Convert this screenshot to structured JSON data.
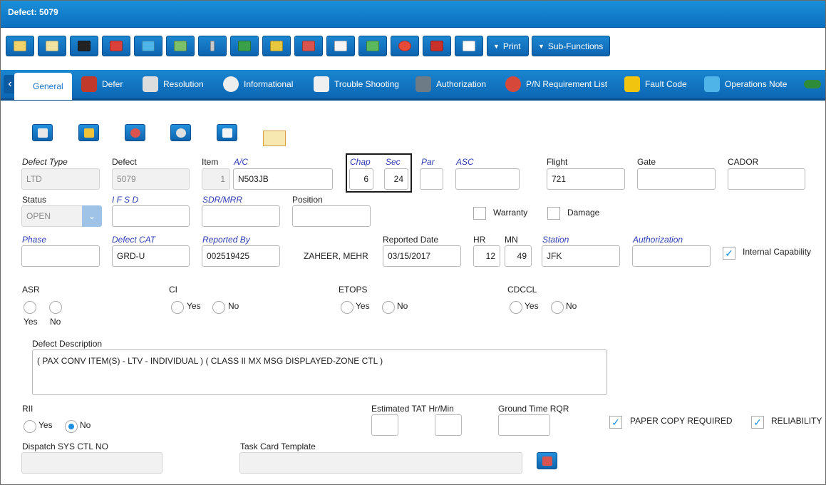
{
  "window": {
    "title": "Defect: 5079"
  },
  "toolbar": {
    "print_label": "Print",
    "subfunctions_label": "Sub-Functions",
    "buttons": [
      "new-icon",
      "copy-icon",
      "save-icon",
      "eraser-icon",
      "book-icon",
      "image-icon",
      "attach-icon",
      "checkmark-icon",
      "plane-icon",
      "parts-icon",
      "document-icon",
      "transfer-icon",
      "status-icon",
      "sign-icon",
      "card-icon"
    ]
  },
  "tabs": [
    "General",
    "Defer",
    "Resolution",
    "Informational",
    "Trouble Shooting",
    "Authorization",
    "P/N Requirement List",
    "Fault Code",
    "Operations Note"
  ],
  "form": {
    "defect_type": {
      "label": "Defect Type",
      "value": "LTD"
    },
    "defect": {
      "label": "Defect",
      "value": "5079"
    },
    "item": {
      "label": "Item",
      "value": "1"
    },
    "ac": {
      "label": "A/C",
      "value": "N503JB"
    },
    "chap": {
      "label": "Chap",
      "value": "6"
    },
    "sec": {
      "label": "Sec",
      "value": "24"
    },
    "par": {
      "label": "Par",
      "value": ""
    },
    "asc": {
      "label": "ASC",
      "value": ""
    },
    "flight": {
      "label": "Flight",
      "value": "721"
    },
    "gate": {
      "label": "Gate",
      "value": ""
    },
    "cador": {
      "label": "CADOR",
      "value": ""
    },
    "status": {
      "label": "Status",
      "value": "OPEN"
    },
    "ifsd": {
      "label": "I F S D",
      "value": ""
    },
    "sdr_mrr": {
      "label": "SDR/MRR",
      "value": ""
    },
    "position": {
      "label": "Position",
      "value": ""
    },
    "warranty": {
      "label": "Warranty",
      "checked": false
    },
    "damage": {
      "label": "Damage",
      "checked": false
    },
    "phase": {
      "label": "Phase",
      "value": ""
    },
    "defect_cat": {
      "label": "Defect CAT",
      "value": "GRD-U"
    },
    "reported_by": {
      "label": "Reported By",
      "value": "002519425",
      "name": "ZAHEER, MEHR"
    },
    "reported_date": {
      "label": "Reported Date",
      "value": "03/15/2017"
    },
    "hr": {
      "label": "HR",
      "value": "12"
    },
    "mn": {
      "label": "MN",
      "value": "49"
    },
    "station": {
      "label": "Station",
      "value": "JFK"
    },
    "authorization": {
      "label": "Authorization",
      "value": ""
    },
    "internal_capability": {
      "label": "Internal Capability",
      "checked": true
    },
    "asr": {
      "label": "ASR",
      "yes": "Yes",
      "no": "No"
    },
    "ci": {
      "label": "CI",
      "yes": "Yes",
      "no": "No"
    },
    "etops": {
      "label": "ETOPS",
      "yes": "Yes",
      "no": "No"
    },
    "cdccl": {
      "label": "CDCCL",
      "yes": "Yes",
      "no": "No"
    },
    "defect_description": {
      "label": "Defect Description",
      "value": "( PAX CONV ITEM(S) - LTV - INDIVIDUAL ) ( CLASS II MX MSG DISPLAYED-ZONE CTL )"
    },
    "rii": {
      "label": "RII",
      "yes": "Yes",
      "no": "No",
      "selected": "No"
    },
    "estimated_tat": {
      "label": "Estimated TAT Hr/Min",
      "hr": "",
      "min": ""
    },
    "ground_time": {
      "label": "Ground Time RQR",
      "value": ""
    },
    "paper_copy": {
      "label": "PAPER COPY REQUIRED",
      "checked": true
    },
    "reliability": {
      "label": "RELIABILITY",
      "checked": true
    },
    "dispatch": {
      "label": "Dispatch SYS CTL NO",
      "value": ""
    },
    "task_card": {
      "label": "Task Card Template",
      "value": ""
    }
  }
}
